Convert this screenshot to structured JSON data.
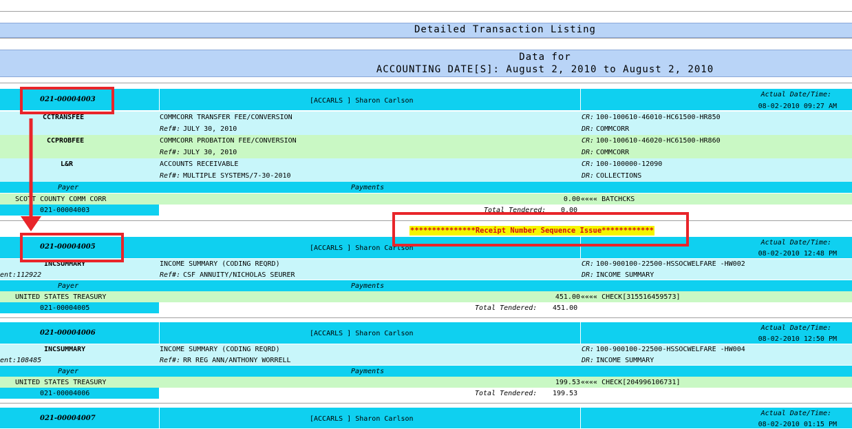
{
  "report": {
    "title": "Detailed Transaction Listing",
    "subtitle_line1": "Data for",
    "subtitle_line2": "ACCOUNTING DATE[S]: August 2, 2010 to August 2, 2010"
  },
  "labels": {
    "actual": "Actual Date/Time:",
    "payer": "Payer",
    "payments": "Payments",
    "total": "Total Tendered:",
    "ref": "Ref#:",
    "cr": "CR:",
    "dr": "DR:"
  },
  "annotation": {
    "notice": "***************Receipt Number Sequence Issue************"
  },
  "receipts": [
    {
      "number": "021-00004003",
      "user": "[ACCARLS ] Sharon Carlson",
      "datetime": "08-02-2010 09:27 AM",
      "lines": [
        {
          "code": "CCTRANSFEE",
          "desc": "COMMCORR TRANSFER FEE/CONVERSION",
          "ref": "JULY 30, 2010",
          "cr": "100-100610-46010-HC61500-HR850",
          "dr": "COMMCORR"
        },
        {
          "code": "CCPROBFEE",
          "desc": "COMMCORR PROBATION FEE/CONVERSION",
          "ref": "JULY 30, 2010",
          "cr": "100-100610-46020-HC61500-HR860",
          "dr": "COMMCORR"
        },
        {
          "code": "L&R",
          "desc": "ACCOUNTS RECEIVABLE",
          "ref": "MULTIPLE SYSTEMS/7-30-2010",
          "cr": "100-100000-12090",
          "dr": "COLLECTIONS"
        }
      ],
      "payer": "SCOTT COUNTY COMM CORR",
      "amount": "0.00",
      "tender": "«««« BATCHCKS",
      "total": "0.00"
    },
    {
      "number": "021-00004005",
      "user": "[ACCARLS ] Sharon Carlson",
      "datetime": "08-02-2010 12:48 PM",
      "lines": [
        {
          "code": "INCSUMMARY",
          "left": "ent:112922",
          "desc": "INCOME SUMMARY (CODING REQRD)",
          "ref": "CSF ANNUITY/NICHOLAS SEURER",
          "cr": "100-900100-22500-HSSOCWELFARE -HW002",
          "dr": "INCOME SUMMARY"
        }
      ],
      "payer": "UNITED STATES TREASURY",
      "amount": "451.00",
      "tender": "«««« CHECK[315516459573]",
      "total": "451.00"
    },
    {
      "number": "021-00004006",
      "user": "[ACCARLS ] Sharon Carlson",
      "datetime": "08-02-2010 12:50 PM",
      "lines": [
        {
          "code": "INCSUMMARY",
          "left": "ent:108485",
          "desc": "INCOME SUMMARY (CODING REQRD)",
          "ref": "RR REG ANN/ANTHONY WORRELL",
          "cr": "100-900100-22500-HSSOCWELFARE -HW004",
          "dr": "INCOME SUMMARY"
        }
      ],
      "payer": "UNITED STATES TREASURY",
      "amount": "199.53",
      "tender": "«««« CHECK[204996106731]",
      "total": "199.53"
    },
    {
      "number": "021-00004007",
      "user": "[ACCARLS ] Sharon Carlson",
      "datetime": "08-02-2010 01:15 PM"
    }
  ],
  "colors": {
    "header_band": "#b9d4f7",
    "receipt_header": "#0fd0f0",
    "line_row": "#c8f6fa",
    "payer_row": "#c9f8c4",
    "annotation_red": "#e8252a",
    "notice_bg": "#f5f500"
  }
}
